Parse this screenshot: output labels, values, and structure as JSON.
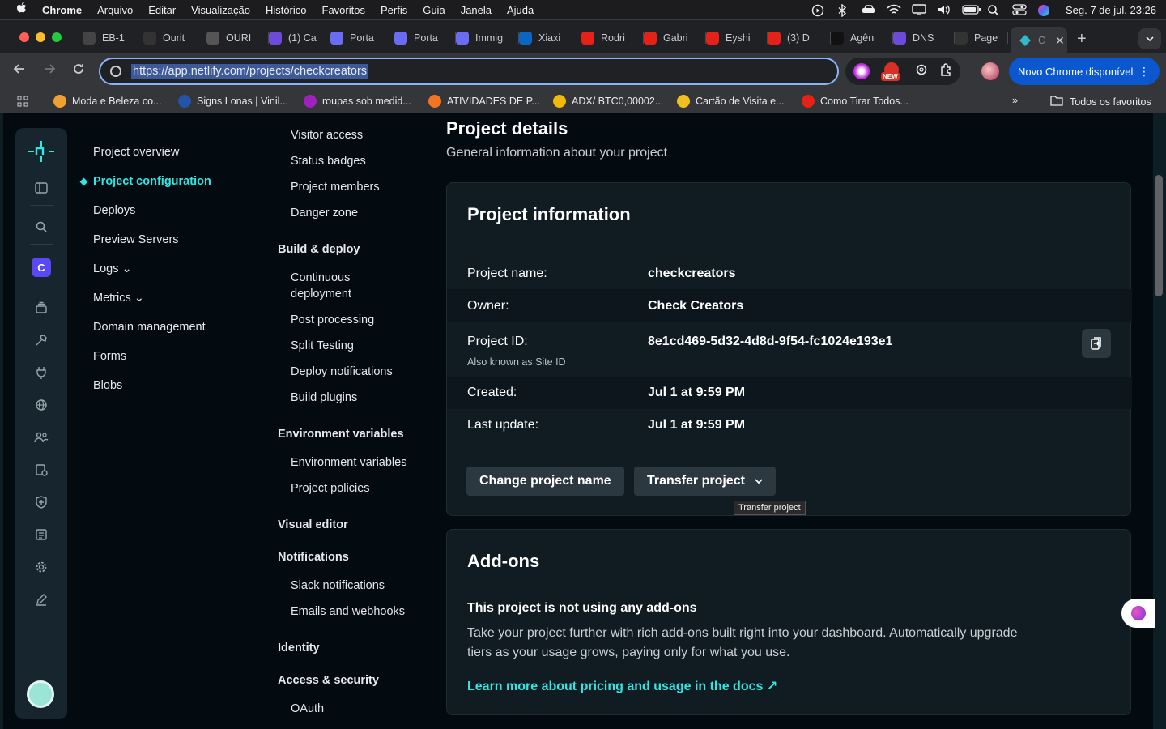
{
  "menubar": {
    "apple": "",
    "items": [
      "Chrome",
      "Arquivo",
      "Editar",
      "Visualização",
      "Histórico",
      "Favoritos",
      "Perfis",
      "Guia",
      "Janela",
      "Ajuda"
    ],
    "clock": "Seg. 7 de jul.  23:26"
  },
  "tabs": [
    {
      "label": "EB-1",
      "color": "#444",
      "icon": "chatgpt-icon"
    },
    {
      "label": "Ourit",
      "color": "#333",
      "icon": "loader-icon"
    },
    {
      "label": "OURI",
      "color": "#555",
      "icon": "perplexity-icon"
    },
    {
      "label": "(1) Ca",
      "color": "#6b4bd8",
      "icon": "clickup-icon"
    },
    {
      "label": "Porta",
      "color": "#6a6cf6",
      "icon": "portal-icon"
    },
    {
      "label": "Porta",
      "color": "#6a6cf6",
      "icon": "portal-icon"
    },
    {
      "label": "Immig",
      "color": "#6a6cf6",
      "icon": "portal-icon"
    },
    {
      "label": "Xiaxi",
      "color": "#0a66c2",
      "icon": "linkedin-icon"
    },
    {
      "label": "Rodri",
      "color": "#e62117",
      "icon": "youtube-icon"
    },
    {
      "label": "Gabri",
      "color": "#e62117",
      "icon": "youtube-icon"
    },
    {
      "label": "Eyshi",
      "color": "#e62117",
      "icon": "youtube-icon"
    },
    {
      "label": "(3) D",
      "color": "#e62117",
      "icon": "youtube-icon"
    },
    {
      "label": "Agên",
      "color": "#111",
      "icon": "agent-icon"
    },
    {
      "label": "DNS",
      "color": "#6b4bd8",
      "icon": "clickup-icon"
    },
    {
      "label": "Page",
      "color": "#333",
      "icon": "github-icon"
    }
  ],
  "active_tab": {
    "label": "C",
    "color": "#32b8c6"
  },
  "omnibox": {
    "url": "https://app.netlify.com/projects/checkcreators"
  },
  "extensions": {
    "new_badge": "NEW"
  },
  "update_button": "Novo Chrome disponível",
  "bookmarks": [
    {
      "label": "Moda e Beleza co...",
      "color": "#f0a030"
    },
    {
      "label": "Signs Lonas | Vinil...",
      "color": "#2255aa"
    },
    {
      "label": "roupas sob medid...",
      "color": "#a020c0"
    },
    {
      "label": "ATIVIDADES DE P...",
      "color": "#f47421"
    },
    {
      "label": "ADX/ BTC0,00002...",
      "color": "#f0b90b"
    },
    {
      "label": "Cartão de Visita e...",
      "color": "#f0c020"
    },
    {
      "label": "Como Tirar Todos...",
      "color": "#e62117"
    }
  ],
  "bookmarks_all": "Todos os favoritos",
  "sidebar": {
    "items": [
      {
        "label": "Project overview"
      },
      {
        "label": "Project configuration",
        "active": true
      },
      {
        "label": "Deploys"
      },
      {
        "label": "Preview Servers"
      },
      {
        "label": "Logs ⌄"
      },
      {
        "label": "Metrics ⌄"
      },
      {
        "label": "Domain management"
      },
      {
        "label": "Forms"
      },
      {
        "label": "Blobs"
      }
    ]
  },
  "subnav": {
    "top_items": [
      "Visitor access",
      "Status badges",
      "Project members",
      "Danger zone"
    ],
    "build_deploy": {
      "title": "Build & deploy",
      "items": [
        "Continuous deployment",
        "Post processing",
        "Split Testing",
        "Deploy notifications",
        "Build plugins"
      ]
    },
    "env": {
      "title": "Environment variables",
      "items": [
        "Environment variables",
        "Project policies"
      ]
    },
    "visual_editor": "Visual editor",
    "notifications": {
      "title": "Notifications",
      "items": [
        "Slack notifications",
        "Emails and webhooks"
      ]
    },
    "identity": "Identity",
    "access": {
      "title": "Access & security",
      "items": [
        "OAuth"
      ]
    }
  },
  "main": {
    "title": "Project details",
    "subtitle": "General information about your project",
    "info_card": {
      "title": "Project information",
      "rows": [
        {
          "key": "Project name:",
          "value": "checkcreators"
        },
        {
          "key": "Owner:",
          "value": "Check Creators"
        },
        {
          "key": "Project ID:",
          "value": "8e1cd469-5d32-4d8d-9f54-fc1024e193e1",
          "note": "Also known as Site ID"
        },
        {
          "key": "Created:",
          "value": "Jul 1 at 9:59 PM"
        },
        {
          "key": "Last update:",
          "value": "Jul 1 at 9:59 PM"
        }
      ],
      "change_name_button": "Change project name",
      "transfer_button": "Transfer project",
      "tooltip": "Transfer project"
    },
    "addons_card": {
      "title": "Add-ons",
      "heading": "This project is not using any add-ons",
      "body": "Take your project further with rich add-ons built right into your dashboard. Automatically upgrade tiers as your usage grows, paying only for what you use.",
      "link": "Learn more about pricing and usage in the docs ↗"
    }
  },
  "rail": {
    "site_initial": "C"
  }
}
